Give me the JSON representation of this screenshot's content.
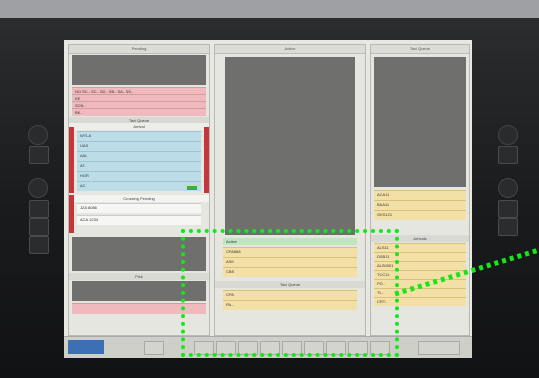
{
  "columns": {
    "left_header": "Pending",
    "mid_header": "Active",
    "right_header": "Taxi Queue",
    "arrivals_header": "Arrivals"
  },
  "left": {
    "pink_strips": [
      "NO SC.. SC.. SD.. SB.. SA.. 5S..",
      "KE",
      "SCN..",
      "BK.."
    ],
    "panel_label": "Taxi Queue",
    "panel_sub": "Arrival",
    "blue_strips": [
      "WTLA",
      "UAS",
      "AAL",
      "AT..",
      "HOR",
      "AC"
    ],
    "white_label": "Crossing Pending",
    "white_strips": [
      "JZA 8086",
      "ACA 1234"
    ],
    "bottom_label": "Pick"
  },
  "middle": {
    "panel_title": "Active",
    "yellow_strips": [
      "CPA888",
      "ASK",
      "CBS",
      "CPA",
      "PA..."
    ],
    "panel2_label": "Taxi Queue"
  },
  "right": {
    "yellow_strips": [
      "ACA11",
      "BAA11",
      "GKS121"
    ],
    "arrivals_strips": [
      "ALS11",
      "DSB11",
      "ALS0001",
      "TCC11",
      "PG..",
      "TL..",
      "CRT.."
    ]
  },
  "colors": {
    "overlay": "#19e619",
    "strip_red": "#c3363a"
  }
}
